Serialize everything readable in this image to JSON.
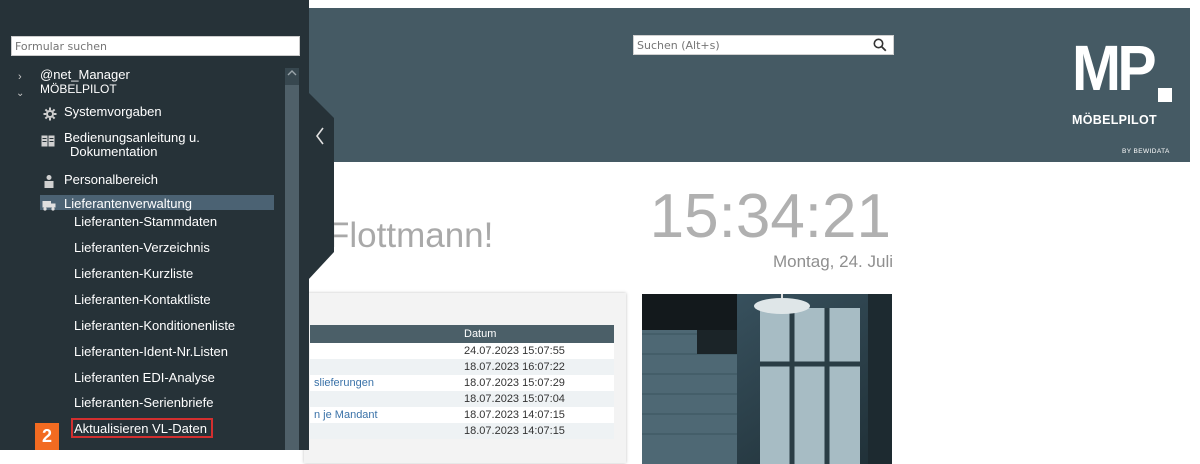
{
  "header": {
    "search_placeholder": "Suchen (Alt+s)",
    "logo_mark": "MP",
    "logo_name": "MÖBELPILOT",
    "logo_by": "BY BEWIDATA"
  },
  "sidebar": {
    "form_search_placeholder": "Formular suchen",
    "tree": [
      {
        "label": "@net_Manager",
        "expanded": false
      },
      {
        "label": "MÖBELPILOT",
        "expanded": true
      }
    ],
    "items": [
      {
        "label": "Systemvorgaben",
        "icon": "gear-icon"
      },
      {
        "label_line1": "Bedienungsanleitung u.",
        "label_line2": "Dokumentation",
        "icon": "book-icon"
      },
      {
        "label": "Personalbereich",
        "icon": "person-icon"
      },
      {
        "label": "Lieferantenverwaltung",
        "icon": "truck-icon",
        "selected": true
      }
    ],
    "subitems": [
      "Lieferanten-Stammdaten",
      "Lieferanten-Verzeichnis",
      "Lieferanten-Kurzliste",
      "Lieferanten-Kontaktliste",
      "Lieferanten-Konditionenliste",
      "Lieferanten-Ident-Nr.Listen",
      "Lieferanten EDI-Analyse",
      "Lieferanten-Serienbriefe",
      "Aktualisieren VL-Daten"
    ],
    "step_badge": "2",
    "colors": {
      "background": "#263238",
      "selected": "#4b6273",
      "marker": "#d32f2f",
      "badge": "#f26b21"
    }
  },
  "main": {
    "greeting": "Flottmann!",
    "clock": "15:34:21",
    "date": "Montag, 24. Juli",
    "table": {
      "headers": [
        "",
        "Datum"
      ],
      "rows": [
        {
          "title": "",
          "date": "24.07.2023 15:07:55"
        },
        {
          "title": "",
          "date": "18.07.2023 16:07:22"
        },
        {
          "title": "slieferungen",
          "date": "18.07.2023 15:07:29"
        },
        {
          "title": "",
          "date": "18.07.2023 15:07:04"
        },
        {
          "title": "n je Mandant",
          "date": "18.07.2023 14:07:15"
        },
        {
          "title": "",
          "date": "18.07.2023 14:07:15"
        }
      ]
    }
  }
}
